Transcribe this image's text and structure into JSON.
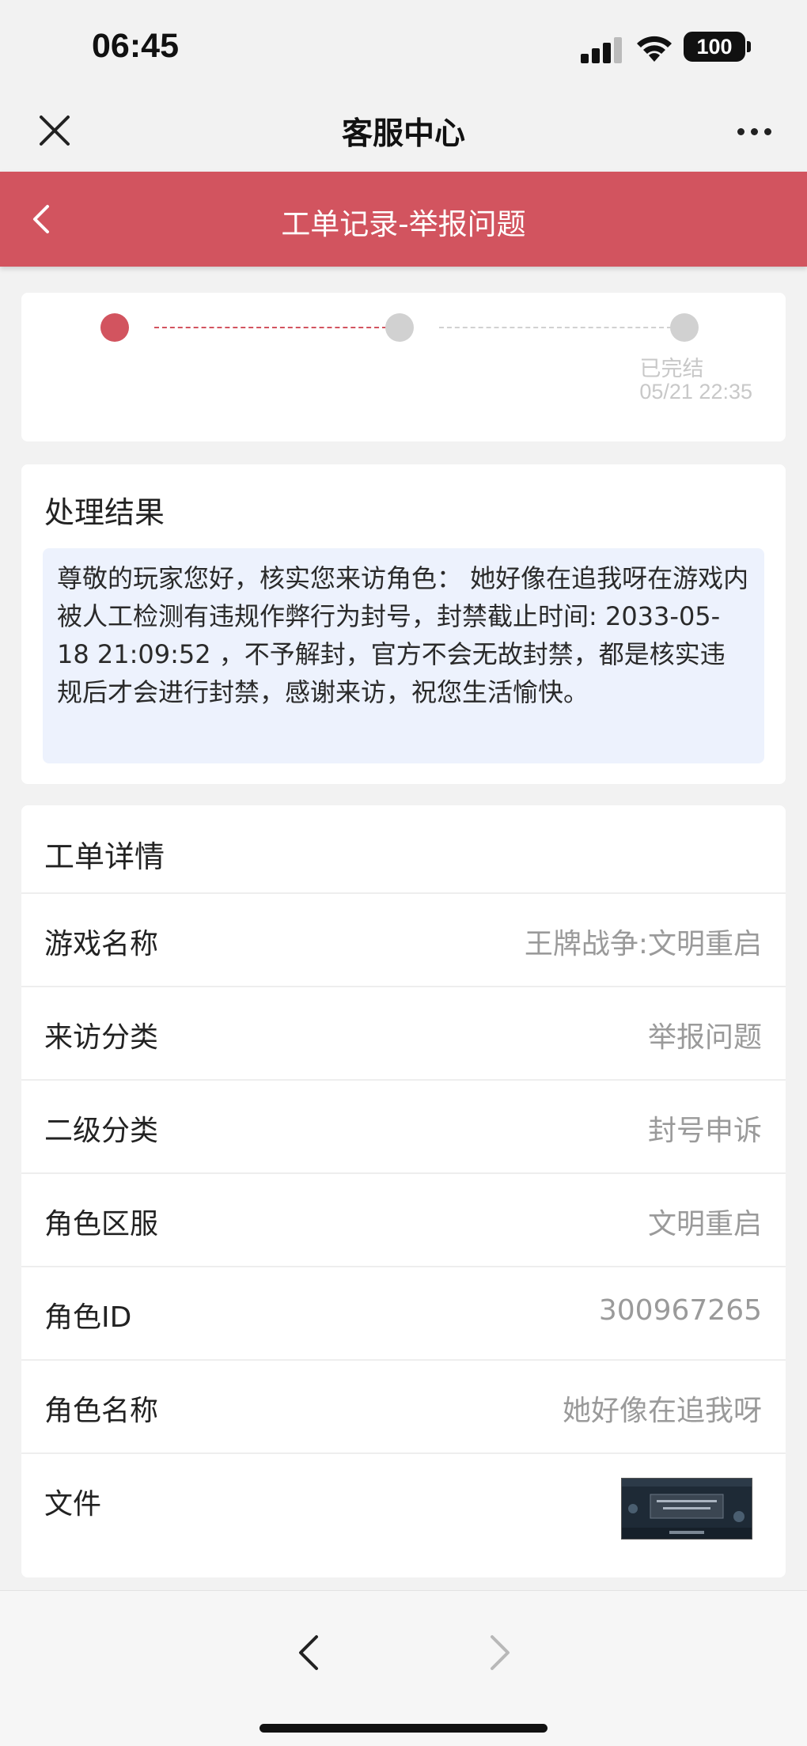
{
  "status_bar": {
    "time": "06:45",
    "battery": "100"
  },
  "nav": {
    "title": "客服中心"
  },
  "header": {
    "title": "工单记录-举报问题",
    "color": "#d2545f"
  },
  "progress": {
    "final_status": "已完结",
    "final_time": "05/21 22:35",
    "active_step": 1,
    "total_steps": 3
  },
  "result": {
    "heading": "处理结果",
    "message": "尊敬的玩家您好，核实您来访角色： 她好像在追我呀在游戏内被人工检测有违规作弊行为封号，封禁截止时间: 2033-05-18 21:09:52 ，不予解封，官方不会无故封禁，都是核实违规后才会进行封禁，感谢来访，祝您生活愉快。"
  },
  "details": {
    "heading": "工单详情",
    "rows": [
      {
        "label": "游戏名称",
        "value": "王牌战争:文明重启"
      },
      {
        "label": "来访分类",
        "value": "举报问题"
      },
      {
        "label": "二级分类",
        "value": "封号申诉"
      },
      {
        "label": "角色区服",
        "value": "文明重启"
      },
      {
        "label": "角色ID",
        "value": "300967265"
      },
      {
        "label": "角色名称",
        "value": "她好像在追我呀"
      }
    ],
    "file_label": "文件"
  },
  "icons": {
    "close": "close-icon",
    "more": "more-icon",
    "back": "chevron-left-icon",
    "nav_back": "chevron-left-icon",
    "nav_forward": "chevron-right-icon"
  }
}
